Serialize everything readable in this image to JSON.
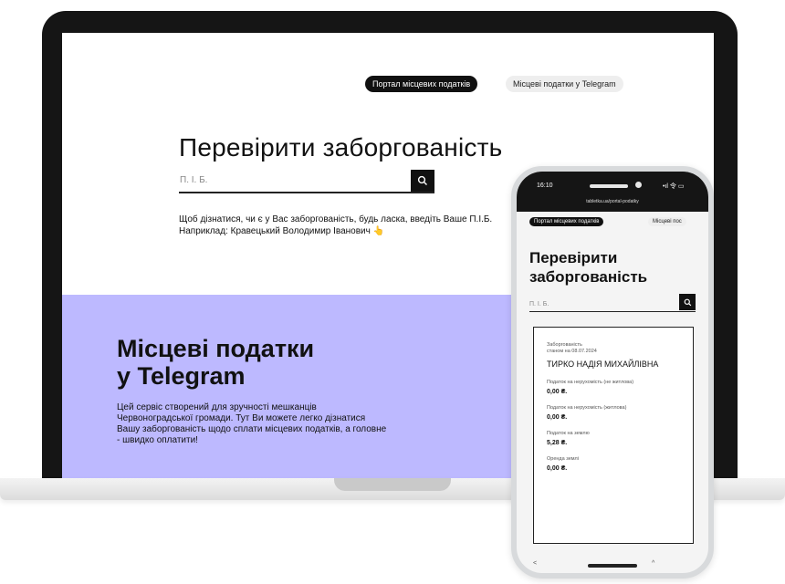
{
  "desktop": {
    "nav": {
      "portal_label": "Портал місцевих податків",
      "telegram_label": "Місцеві податки у Telegram"
    },
    "title": "Перевірити заборгованість",
    "search": {
      "placeholder": "П. І. Б."
    },
    "hint": "Щоб дізнатися, чи є у Вас заборгованість, будь ласка, введіть Ваше П.І.Б. Наприклад: Кравецький Володимир Іванович 👆",
    "telegram_section": {
      "title_line1": "Місцеві податки",
      "title_line2": "у Telegram",
      "text": "Цей сервіс створений для зручності мешканців Червоноградської громади. Тут Ви можете легко дізнатися Вашу заборгованість щодо сплати місцевих податків, а головне - швидко оплатити!"
    }
  },
  "mobile": {
    "status": {
      "time": "16:10",
      "signal": "•ıl 令 ▭"
    },
    "url": "tabletka.ua/portal-podatky",
    "nav": {
      "portal_label": "Портал місцевих податків",
      "telegram_label": "Місцеві пос"
    },
    "title": "Перевірити заборгованість",
    "search": {
      "placeholder": "П. І. Б."
    },
    "card": {
      "caption_line1": "Заборгованість",
      "caption_line2": "станом на 08.07.2024",
      "name": "ТИРКО НАДІЯ МИХАЙЛІВНА",
      "rows": [
        {
          "label": "Податок на нерухомість (не житлова)",
          "value": "0,00 ₴."
        },
        {
          "label": "Податок на нерухомість (житлова)",
          "value": "0,00 ₴."
        },
        {
          "label": "Податок на землю",
          "value": "5,28 ₴."
        },
        {
          "label": "Оренда землі",
          "value": "0,00 ₴."
        }
      ]
    },
    "bottom": {
      "back": "<",
      "forward": "^"
    }
  },
  "icons": {
    "search": "search-icon"
  },
  "colors": {
    "accent_purple": "#bdb9ff",
    "dark": "#111111"
  }
}
